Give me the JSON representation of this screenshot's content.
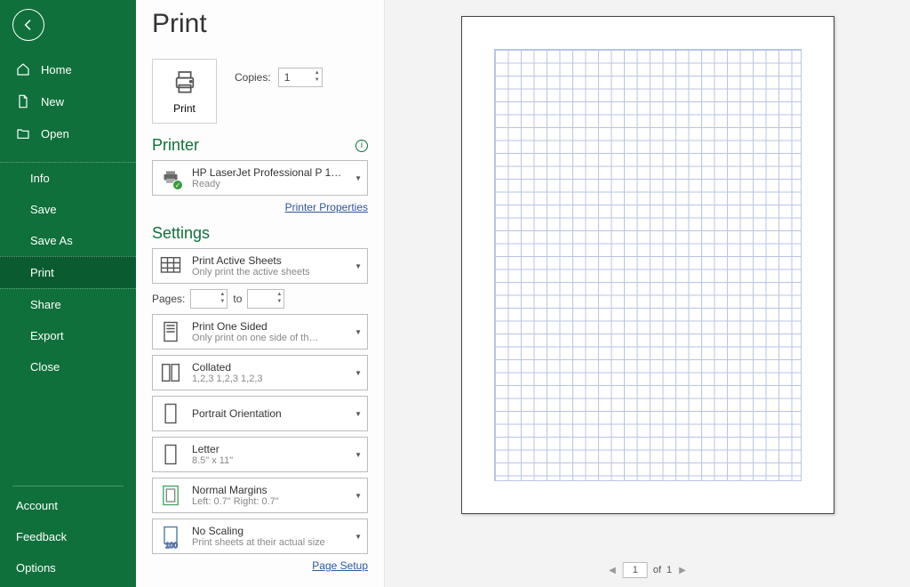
{
  "sidebar": {
    "top": [
      {
        "label": "Home",
        "icon": "home-icon"
      },
      {
        "label": "New",
        "icon": "new-icon"
      },
      {
        "label": "Open",
        "icon": "open-icon"
      }
    ],
    "mid": [
      {
        "label": "Info"
      },
      {
        "label": "Save"
      },
      {
        "label": "Save As"
      },
      {
        "label": "Print",
        "selected": true
      },
      {
        "label": "Share"
      },
      {
        "label": "Export"
      },
      {
        "label": "Close"
      }
    ],
    "bottom": [
      {
        "label": "Account"
      },
      {
        "label": "Feedback"
      },
      {
        "label": "Options"
      }
    ]
  },
  "title": "Print",
  "print_button": "Print",
  "copies": {
    "label": "Copies:",
    "value": "1"
  },
  "printer": {
    "heading": "Printer",
    "name": "HP LaserJet Professional P 1…",
    "status": "Ready",
    "properties_link": "Printer Properties"
  },
  "settings": {
    "heading": "Settings",
    "print_area": {
      "title": "Print Active Sheets",
      "sub": "Only print the active sheets"
    },
    "pages_label": "Pages:",
    "pages_to": "to",
    "pages_from": "",
    "pages_to_val": "",
    "sides": {
      "title": "Print One Sided",
      "sub": "Only print on one side of th…"
    },
    "collate": {
      "title": "Collated",
      "sub": "1,2,3    1,2,3    1,2,3"
    },
    "orientation": {
      "title": "Portrait Orientation",
      "sub": ""
    },
    "paper": {
      "title": "Letter",
      "sub": "8.5\" x 11\""
    },
    "margins": {
      "title": "Normal Margins",
      "sub": "Left:  0.7\"    Right:  0.7\""
    },
    "scaling": {
      "title": "No Scaling",
      "sub": "Print sheets at their actual size"
    },
    "page_setup_link": "Page Setup"
  },
  "preview": {
    "current": "1",
    "of_label": "of",
    "total": "1"
  }
}
